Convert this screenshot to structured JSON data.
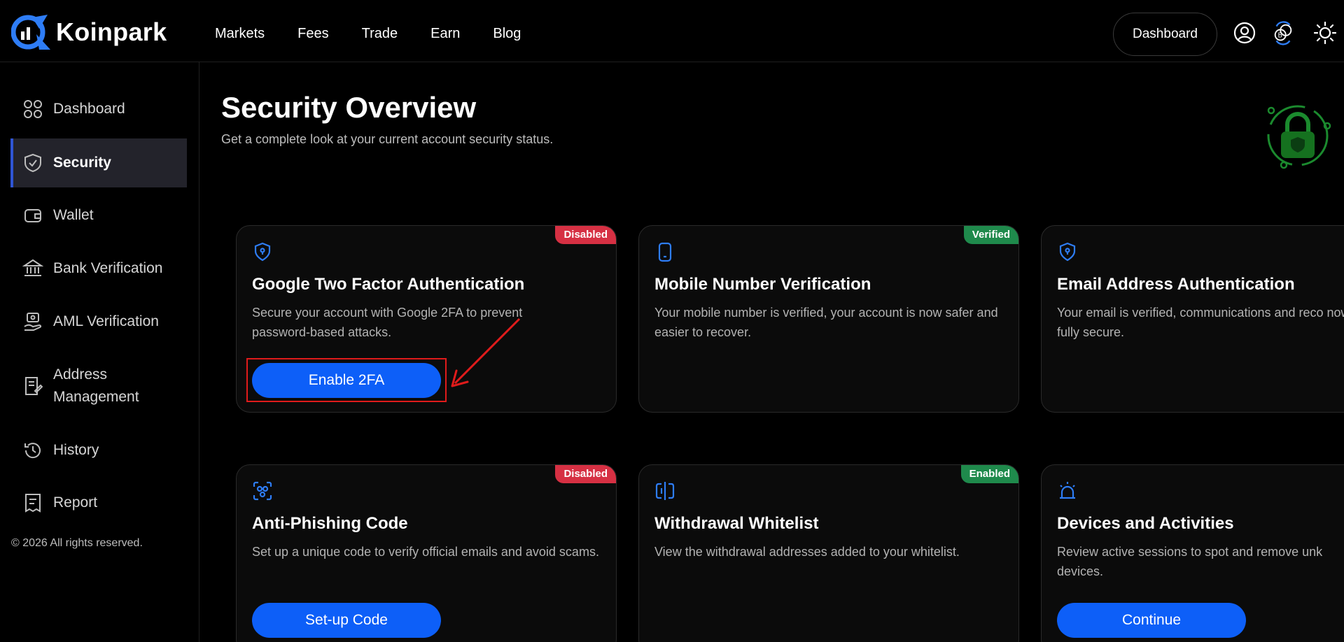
{
  "app": {
    "brand": "Koinpark",
    "colors": {
      "accent": "#0d5ff8",
      "danger": "#d63043",
      "success": "#1f8a4c",
      "active_bar": "#2f55d4"
    }
  },
  "header": {
    "nav": [
      "Markets",
      "Fees",
      "Trade",
      "Earn",
      "Blog"
    ],
    "dashboard_button": "Dashboard",
    "icons": [
      "user-icon",
      "currency-exchange-icon",
      "theme-toggle-icon"
    ]
  },
  "sidebar": {
    "items": [
      {
        "label": "Dashboard",
        "icon": "grid-icon",
        "active": false
      },
      {
        "label": "Security",
        "icon": "shield-icon",
        "active": true
      },
      {
        "label": "Wallet",
        "icon": "wallet-icon",
        "active": false
      },
      {
        "label": "Bank Verification",
        "icon": "bank-icon",
        "active": false
      },
      {
        "label": "AML Verification",
        "icon": "aml-icon",
        "active": false
      },
      {
        "label": "Address\nManagement",
        "icon": "address-icon",
        "active": false
      },
      {
        "label": "History",
        "icon": "history-icon",
        "active": false
      },
      {
        "label": "Report",
        "icon": "report-icon",
        "active": false
      }
    ],
    "copyright": "© 2026 All rights reserved."
  },
  "main": {
    "title": "Security Overview",
    "subtitle": "Get a complete look at your current account security status.",
    "cards": [
      {
        "title": "Google Two Factor Authentication",
        "desc": "Secure your account with Google 2FA to prevent password-based attacks.",
        "badge": "Disabled",
        "button": "Enable 2FA"
      },
      {
        "title": "Mobile Number Verification",
        "desc": "Your mobile number is verified, your account is now safer and easier to recover.",
        "badge": "Verified"
      },
      {
        "title": "Email Address Authentication",
        "desc": "Your email is verified, communications and reco now fully secure."
      },
      {
        "title": "Anti-Phishing Code",
        "desc": "Set up a unique code to verify official emails and avoid scams.",
        "badge": "Disabled",
        "button": "Set-up Code"
      },
      {
        "title": "Withdrawal Whitelist",
        "desc": "View the withdrawal addresses added to your whitelist.",
        "badge": "Enabled"
      },
      {
        "title": "Devices and Activities",
        "desc": "Review active sessions to spot and remove unk devices.",
        "button": "Continue"
      }
    ]
  }
}
